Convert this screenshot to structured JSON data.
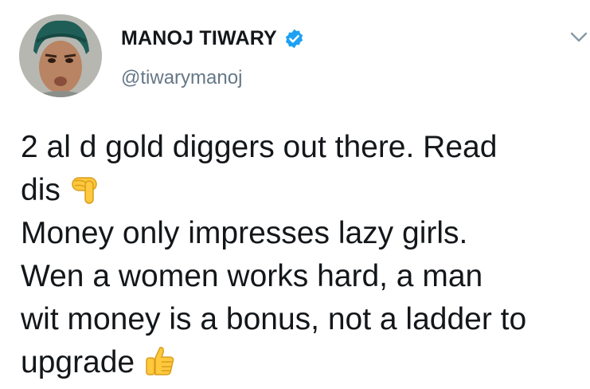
{
  "author": {
    "display_name": "MANOJ TIWARY",
    "handle": "@tiwarymanoj",
    "verified": true,
    "avatar_icon": "profile-photo"
  },
  "menu_icon": "chevron-down-icon",
  "tweet": {
    "lines": [
      "2 al d gold diggers out there. Read",
      "dis",
      "Money only impresses lazy girls.",
      "Wen a women works hard, a man",
      "wit money is a bonus, not a ladder to",
      "upgrade"
    ],
    "emojis": {
      "after_line_2": "backhand-index-pointing-down",
      "after_line_6": "thumbs-up"
    }
  },
  "colors": {
    "text": "#14171a",
    "handle": "#657786",
    "verified_badge": "#1da1f2",
    "emoji": "#ffc83d"
  }
}
